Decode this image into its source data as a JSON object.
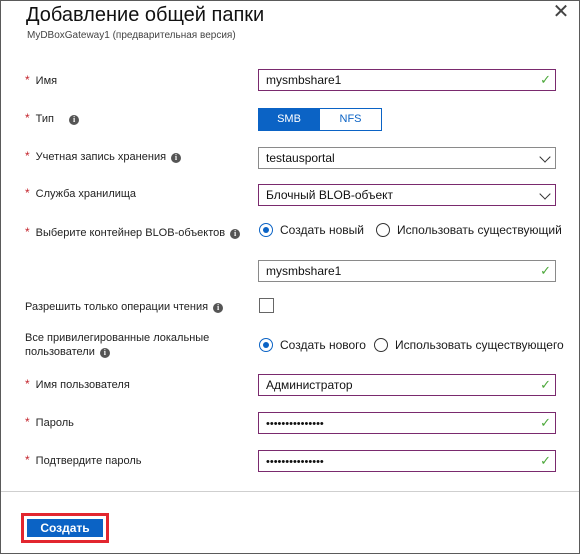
{
  "header": {
    "title": "Добавление общей папки",
    "subtitle": "MyDBoxGateway1 (предварительная версия)",
    "close": "✕"
  },
  "form": {
    "name": {
      "label": "Имя",
      "value": "mysmbshare1"
    },
    "type": {
      "label": "Тип",
      "options": [
        "SMB",
        "NFS"
      ],
      "selected": "SMB"
    },
    "storage_account": {
      "label": "Учетная запись хранения",
      "value": "testausportal"
    },
    "storage_service": {
      "label": "Служба хранилища",
      "value": "Блочный BLOB-объект"
    },
    "blob_container": {
      "label": "Выберите контейнер BLOB-объектов",
      "options": [
        "Создать новый",
        "Использовать существующий"
      ],
      "selected": "Создать новый",
      "value": "mysmbshare1"
    },
    "read_only": {
      "label": "Разрешить только операции чтения",
      "checked": false
    },
    "local_users": {
      "label_line1": "Все привилегированные локальные",
      "label_line2": "пользователи",
      "options": [
        "Создать нового",
        "Использовать существующего"
      ],
      "selected": "Создать нового"
    },
    "username": {
      "label": "Имя пользователя",
      "value": "Администратор"
    },
    "password": {
      "label": "Пароль",
      "value": "•••••••••••••••"
    },
    "confirm_password": {
      "label": "Подтвердите пароль",
      "value": "•••••••••••••••"
    }
  },
  "footer": {
    "create_label": "Создать"
  },
  "colors": {
    "accent": "#0b63c5",
    "required": "#c4262e",
    "valid": "#4ca83a",
    "highlight": "#e2262f"
  },
  "icons": {
    "check": "✓",
    "info": "i"
  }
}
